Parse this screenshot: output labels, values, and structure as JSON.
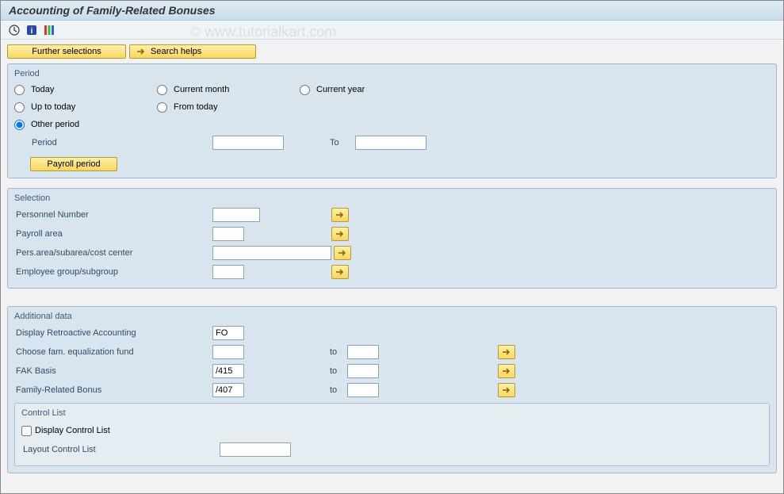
{
  "title": "Accounting of Family-Related Bonuses",
  "watermark": "© www.tutorialkart.com",
  "buttons": {
    "further_selections": "Further selections",
    "search_helps": "Search helps",
    "payroll_period": "Payroll period"
  },
  "period": {
    "legend": "Period",
    "today": "Today",
    "current_month": "Current month",
    "current_year": "Current year",
    "up_to_today": "Up to today",
    "from_today": "From today",
    "other_period": "Other period",
    "period_label": "Period",
    "to_label": "To",
    "period_value": "",
    "to_value": ""
  },
  "selection": {
    "legend": "Selection",
    "personnel_number": "Personnel Number",
    "payroll_area": "Payroll area",
    "pers_area": "Pers.area/subarea/cost center",
    "employee_group": "Employee group/subgroup",
    "personnel_number_val": "",
    "payroll_area_val": "",
    "pers_area_val": "",
    "employee_group_val": ""
  },
  "additional": {
    "legend": "Additional data",
    "display_retro": "Display Retroactive Accounting",
    "display_retro_val": "FO",
    "choose_fam": "Choose fam. equalization fund",
    "fak_basis": "FAK Basis",
    "fak_basis_val": "/415",
    "family_bonus": "Family-Related Bonus",
    "family_bonus_val": "/407",
    "to_label": "to",
    "choose_fam_val": "",
    "choose_fam_to": "",
    "fak_basis_to": "",
    "family_bonus_to": "",
    "control_list": {
      "legend": "Control List",
      "display": "Display Control List",
      "layout": "Layout Control List",
      "layout_val": ""
    }
  }
}
